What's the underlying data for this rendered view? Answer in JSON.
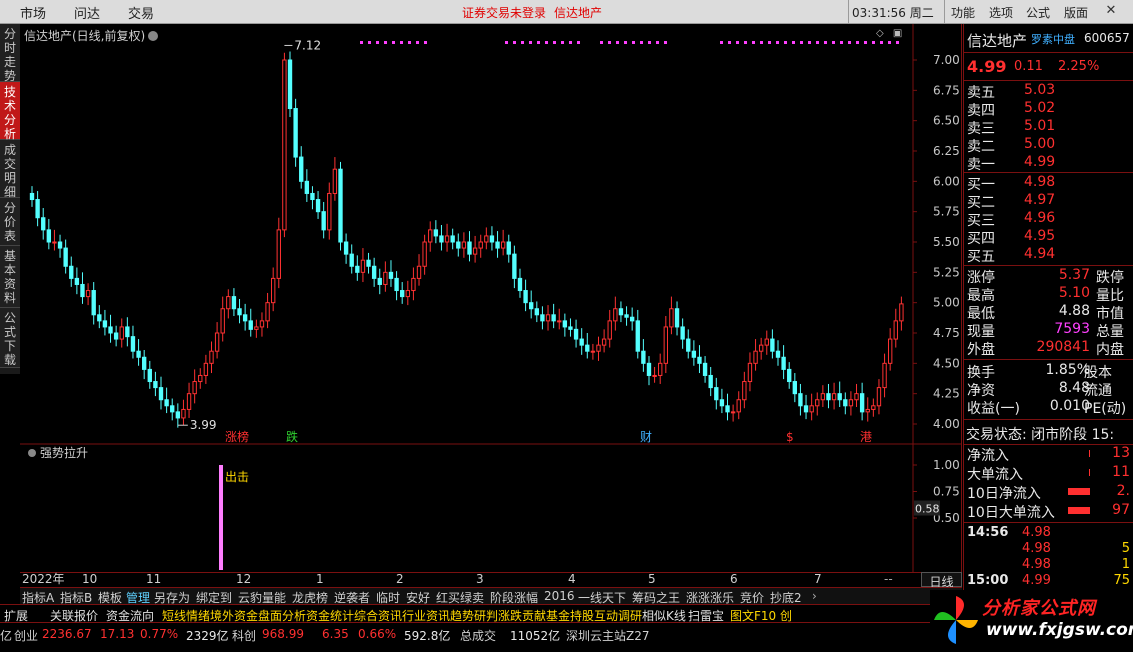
{
  "topbar": {
    "menus": [
      "市场",
      "问达",
      "交易"
    ],
    "notice": "证券交易未登录",
    "stock_name": "信达地产",
    "time": "03:31:56",
    "weekday": "周二",
    "right_menus": [
      "功能",
      "选项",
      "公式",
      "版面"
    ]
  },
  "left_tabs": [
    "分时走势",
    "技术分析",
    "成交明细",
    "分价表",
    "基本资料",
    "公式下载"
  ],
  "main_chart": {
    "title": "信达地产(日线,前复权)",
    "high_annotation": "7.12",
    "low_annotation": "3.99",
    "price_ticks": [
      "7.00",
      "6.75",
      "6.50",
      "6.25",
      "6.00",
      "5.75",
      "5.50",
      "5.25",
      "5.00",
      "4.75",
      "4.50",
      "4.25",
      "4.00"
    ],
    "event_labels": [
      {
        "text": "涨榜",
        "color": "#ff3030"
      },
      {
        "text": "跌",
        "color": "#30d030"
      },
      {
        "text": "财",
        "color": "#40b0ff"
      },
      {
        "text": "$",
        "color": "#ff3030"
      },
      {
        "text": "港",
        "color": "#ff3030"
      }
    ]
  },
  "sub_chart": {
    "title": "强势拉升",
    "signal_label": "出击",
    "ticks": [
      "1.00",
      "0.75",
      "0.50"
    ],
    "current_value": "0.58"
  },
  "chart_data": {
    "type": "candlestick",
    "title": "信达地产(日线,前复权)",
    "ylim": [
      4.0,
      7.12
    ],
    "high": 7.12,
    "low": 3.99,
    "x_labels": [
      "2022年",
      "10",
      "11",
      "12",
      "1",
      "2",
      "3",
      "4",
      "5",
      "6",
      "7"
    ],
    "closes": [
      5.85,
      5.7,
      5.6,
      5.5,
      5.5,
      5.45,
      5.3,
      5.2,
      5.15,
      5.05,
      5.1,
      4.9,
      4.85,
      4.8,
      4.75,
      4.7,
      4.8,
      4.72,
      4.6,
      4.55,
      4.45,
      4.35,
      4.3,
      4.2,
      4.15,
      4.1,
      4.05,
      4.12,
      4.25,
      4.35,
      4.4,
      4.5,
      4.6,
      4.75,
      4.95,
      5.05,
      4.95,
      4.9,
      4.85,
      4.78,
      4.8,
      4.85,
      5.0,
      5.2,
      5.6,
      7.0,
      6.6,
      6.2,
      6.0,
      5.9,
      5.85,
      5.75,
      5.6,
      5.9,
      6.1,
      5.5,
      5.4,
      5.3,
      5.25,
      5.35,
      5.3,
      5.2,
      5.15,
      5.25,
      5.2,
      5.1,
      5.05,
      5.1,
      5.2,
      5.3,
      5.5,
      5.6,
      5.55,
      5.5,
      5.55,
      5.5,
      5.45,
      5.5,
      5.4,
      5.45,
      5.5,
      5.55,
      5.5,
      5.45,
      5.5,
      5.4,
      5.2,
      5.1,
      5.0,
      4.95,
      4.9,
      4.85,
      4.9,
      4.85,
      4.85,
      4.8,
      4.78,
      4.7,
      4.65,
      4.6,
      4.6,
      4.65,
      4.7,
      4.85,
      4.95,
      4.9,
      4.88,
      4.85,
      4.6,
      4.5,
      4.4,
      4.4,
      4.5,
      4.8,
      4.95,
      4.8,
      4.7,
      4.6,
      4.55,
      4.5,
      4.4,
      4.3,
      4.2,
      4.15,
      4.1,
      4.1,
      4.2,
      4.35,
      4.5,
      4.6,
      4.65,
      4.7,
      4.6,
      4.55,
      4.45,
      4.35,
      4.25,
      4.15,
      4.1,
      4.15,
      4.2,
      4.25,
      4.2,
      4.25,
      4.2,
      4.15,
      4.2,
      4.25,
      4.1,
      4.12,
      4.15,
      4.3,
      4.5,
      4.7,
      4.85,
      4.99
    ]
  },
  "bottom_tabs": [
    "指标A",
    "指标B",
    "模板",
    "管理",
    "另存为",
    "绑定到",
    "云豹量能",
    "龙虎榜",
    "逆袭者",
    "临时",
    "安好",
    "红买绿卖",
    "阶段涨幅",
    "2016",
    "一线天下",
    "筹码之王",
    "涨涨涨乐",
    "竞价",
    "抄底2"
  ],
  "active_bottom_tab": "管理",
  "period_label": "日线",
  "bottom_bar": [
    {
      "text": "扩展",
      "color": "#e0e0e0"
    },
    {
      "text": "关联报价",
      "color": "#e0e0e0"
    },
    {
      "text": "资金流向",
      "color": "#e0e0e0"
    },
    {
      "text": "短线情绪",
      "color": "#ffd800"
    },
    {
      "text": "境外资金",
      "color": "#ffd800"
    },
    {
      "text": "盘面分析",
      "color": "#ffd800"
    },
    {
      "text": "资金统计",
      "color": "#ffd800"
    },
    {
      "text": "综合资讯",
      "color": "#ffd800"
    },
    {
      "text": "行业资讯",
      "color": "#ffd800"
    },
    {
      "text": "趋势研判",
      "color": "#ffd800"
    },
    {
      "text": "涨跌贡献",
      "color": "#ffd800"
    },
    {
      "text": "基金持股",
      "color": "#ffd800"
    },
    {
      "text": "互动调研",
      "color": "#ffd800"
    },
    {
      "text": "相似K线",
      "color": "#e0e0e0"
    },
    {
      "text": "扫雷宝",
      "color": "#e0e0e0"
    },
    {
      "text": "图文F10 创",
      "color": "#ffd800"
    }
  ],
  "status_bar": {
    "chuangye_label": "创业",
    "chuangye_value": "2236.67",
    "chuangye_change": "17.13",
    "chuangye_pct": "0.77%",
    "chuangye_amount": "2329亿",
    "kechuang_label": "科创",
    "kechuang_value": "968.99",
    "kechuang_change": "6.35",
    "kechuang_pct": "0.66%",
    "kechuang_amount": "592.8亿",
    "total_label": "总成交",
    "total_value": "11052亿",
    "server": "深圳云主站Z27",
    "prefix": "亿"
  },
  "logo": {
    "name": "分析家公式网",
    "url": "www.fxjgsw.com"
  },
  "quote_panel": {
    "name": "信达地产",
    "tag": "罗素中盘",
    "code": "600657",
    "price": "4.99",
    "change": "0.11",
    "pct": "2.25%",
    "asks": [
      {
        "label": "卖五",
        "price": "5.03"
      },
      {
        "label": "卖四",
        "price": "5.02"
      },
      {
        "label": "卖三",
        "price": "5.01"
      },
      {
        "label": "卖二",
        "price": "5.00"
      },
      {
        "label": "卖一",
        "price": "4.99"
      }
    ],
    "bids": [
      {
        "label": "买一",
        "price": "4.98"
      },
      {
        "label": "买二",
        "price": "4.97"
      },
      {
        "label": "买三",
        "price": "4.96"
      },
      {
        "label": "买四",
        "price": "4.95"
      },
      {
        "label": "买五",
        "price": "4.94"
      }
    ],
    "stats": [
      {
        "l1": "涨停",
        "v1": "5.37",
        "c1": "#ff3030",
        "l2": "跌停"
      },
      {
        "l1": "最高",
        "v1": "5.10",
        "c1": "#ff3030",
        "l2": "量比"
      },
      {
        "l1": "最低",
        "v1": "4.88",
        "c1": "#e8e8e8",
        "l2": "市值"
      },
      {
        "l1": "现量",
        "v1": "7593",
        "c1": "#ff40ff",
        "l2": "总量"
      },
      {
        "l1": "外盘",
        "v1": "290841",
        "c1": "#ff3030",
        "l2": "内盘"
      }
    ],
    "stats2": [
      {
        "l1": "换手",
        "v1": "1.85%",
        "l2": "股本"
      },
      {
        "l1": "净资",
        "v1": "8.48",
        "l2": "流通"
      },
      {
        "l1": "收益(一)",
        "v1": "0.010",
        "l2": "PE(动)"
      }
    ],
    "trade_status": "交易状态: 闭市阶段 15:",
    "flows": [
      {
        "label": "净流入",
        "value": "13",
        "bar": 0.05
      },
      {
        "label": "大单流入",
        "value": "11",
        "bar": 0.05
      },
      {
        "label": "10日净流入",
        "value": "2.",
        "bar": 0.9
      },
      {
        "label": "10日大单流入",
        "value": "97",
        "bar": 0.9
      }
    ],
    "ticks": [
      {
        "time": "14:56",
        "price": "4.98",
        "vol": ""
      },
      {
        "time": "",
        "price": "4.98",
        "vol": "5"
      },
      {
        "time": "",
        "price": "4.98",
        "vol": "1"
      },
      {
        "time": "15:00",
        "price": "4.99",
        "vol": "75"
      }
    ]
  }
}
